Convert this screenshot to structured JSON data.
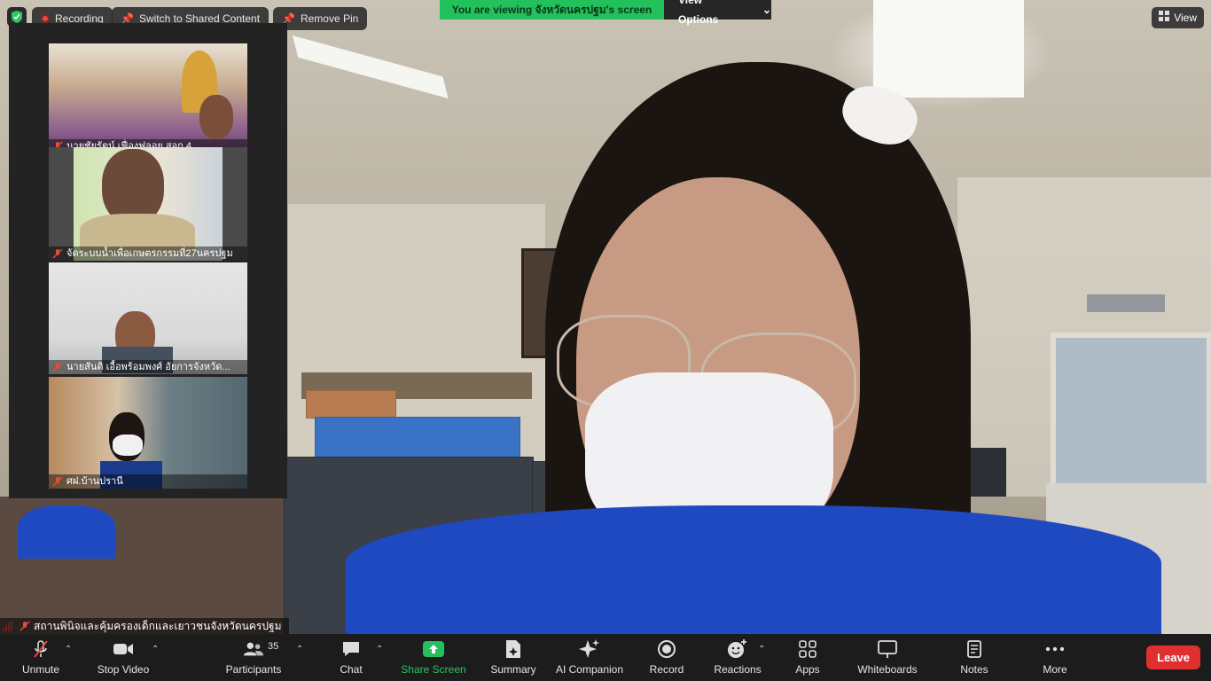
{
  "top": {
    "recording_label": "Recording",
    "switch_label": "Switch to Shared Content",
    "remove_pin_label": "Remove Pin",
    "viewing_text": "You are viewing จังหวัดนครปฐม's screen",
    "view_options_label": "View Options",
    "view_label": "View"
  },
  "thumbnails": [
    {
      "label": "นายชัยรัตน์ เฟื่องฟูลอย สอก.4"
    },
    {
      "label": "จัดระบบน้ำเพื่อเกษตรกรรมที่27นครปฐม"
    },
    {
      "label": "นายสันติ เอื้อพร้อมพงศ์ อัยการจังหวัด..."
    },
    {
      "label": "ศฝ.บ้านปรานี"
    }
  ],
  "speaker": {
    "name": "สถานพินิจและคุ้มครองเด็กและเยาวชนจังหวัดนครปฐม"
  },
  "toolbar": {
    "unmute": "Unmute",
    "stop_video": "Stop Video",
    "participants": "Participants",
    "participants_count": "35",
    "chat": "Chat",
    "share_screen": "Share Screen",
    "summary": "Summary",
    "ai_companion": "AI Companion",
    "record": "Record",
    "reactions": "Reactions",
    "apps": "Apps",
    "whiteboards": "Whiteboards",
    "notes": "Notes",
    "more": "More",
    "leave": "Leave"
  },
  "colors": {
    "share_green": "#23c15b",
    "leave_red": "#e02f2f",
    "toolbar_bg": "#1c1c1c"
  }
}
